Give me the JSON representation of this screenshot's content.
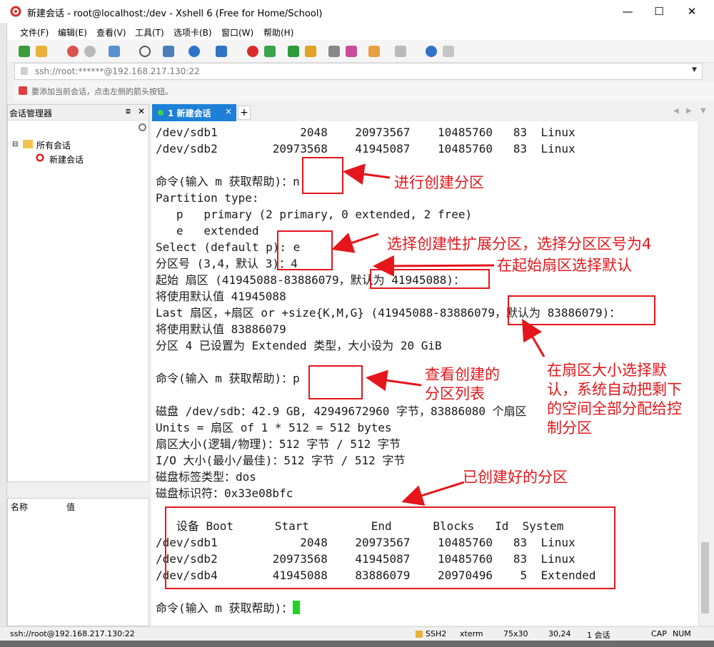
{
  "window": {
    "title": "新建会话 - root@localhost:/dev - Xshell 6 (Free for Home/School)"
  },
  "menu": [
    "文件(F)",
    "编辑(E)",
    "查看(V)",
    "工具(T)",
    "选项卡(B)",
    "窗口(W)",
    "帮助(H)"
  ],
  "address": {
    "value": "ssh://root:******@192.168.217.130:22"
  },
  "hint": {
    "text": "要添加当前会话，点击左侧的箭头按钮。"
  },
  "session_manager": {
    "title": "会话管理器",
    "root": "所有会话",
    "child": "新建会话"
  },
  "properties": {
    "col_name": "名称",
    "col_value": "值"
  },
  "tab": {
    "label": "1 新建会话",
    "close": "×",
    "add": "+"
  },
  "terminal": {
    "lines": [
      "/dev/sdb1            2048    20973567    10485760   83  Linux",
      "/dev/sdb2        20973568    41945087    10485760   83  Linux",
      "",
      "命令(输入 m 获取帮助)：n",
      "Partition type:",
      "   p   primary (2 primary, 0 extended, 2 free)",
      "   e   extended",
      "Select (default p): e",
      "分区号 (3,4，默认 3)：4",
      "起始 扇区 (41945088-83886079，默认为 41945088)：",
      "将使用默认值 41945088",
      "Last 扇区，+扇区 or +size{K,M,G} (41945088-83886079，默认为 83886079)：",
      "将使用默认值 83886079",
      "分区 4 已设置为 Extended 类型，大小设为 20 GiB",
      "",
      "命令(输入 m 获取帮助)：p",
      "",
      "磁盘 /dev/sdb：42.9 GB, 42949672960 字节，83886080 个扇区",
      "Units = 扇区 of 1 * 512 = 512 bytes",
      "扇区大小(逻辑/物理)：512 字节 / 512 字节",
      "I/O 大小(最小/最佳)：512 字节 / 512 字节",
      "磁盘标签类型：dos",
      "磁盘标识符：0x33e08bfc",
      "",
      "   设备 Boot      Start         End      Blocks   Id  System",
      "/dev/sdb1            2048    20973567    10485760   83  Linux",
      "/dev/sdb2        20973568    41945087    10485760   83  Linux",
      "/dev/sdb4        41945088    83886079    20970496    5  Extended",
      "",
      "命令(输入 m 获取帮助)："
    ]
  },
  "annotations": {
    "a1": "进行创建分区",
    "a2": "选择创建性扩展分区，选择分区区号为4",
    "a3": "在起始扇区选择默认",
    "a4": "查看创建的\n分区列表",
    "a5": "在扇区大小选择默\n认，系统自动把剩下\n的空间全部分配给控\n制分区",
    "a6": "已创建好的分区"
  },
  "status": {
    "left": "ssh://root@192.168.217.130:22",
    "proto": "SSH2",
    "term": "xterm",
    "size": "75x30",
    "pos": "30,24",
    "sessions": "1 会话",
    "caps": "CAP",
    "num": "NUM"
  },
  "colors": {
    "tab_active": "#1e7fd6",
    "annotation": "#e4161b",
    "cursor": "#22d322"
  }
}
